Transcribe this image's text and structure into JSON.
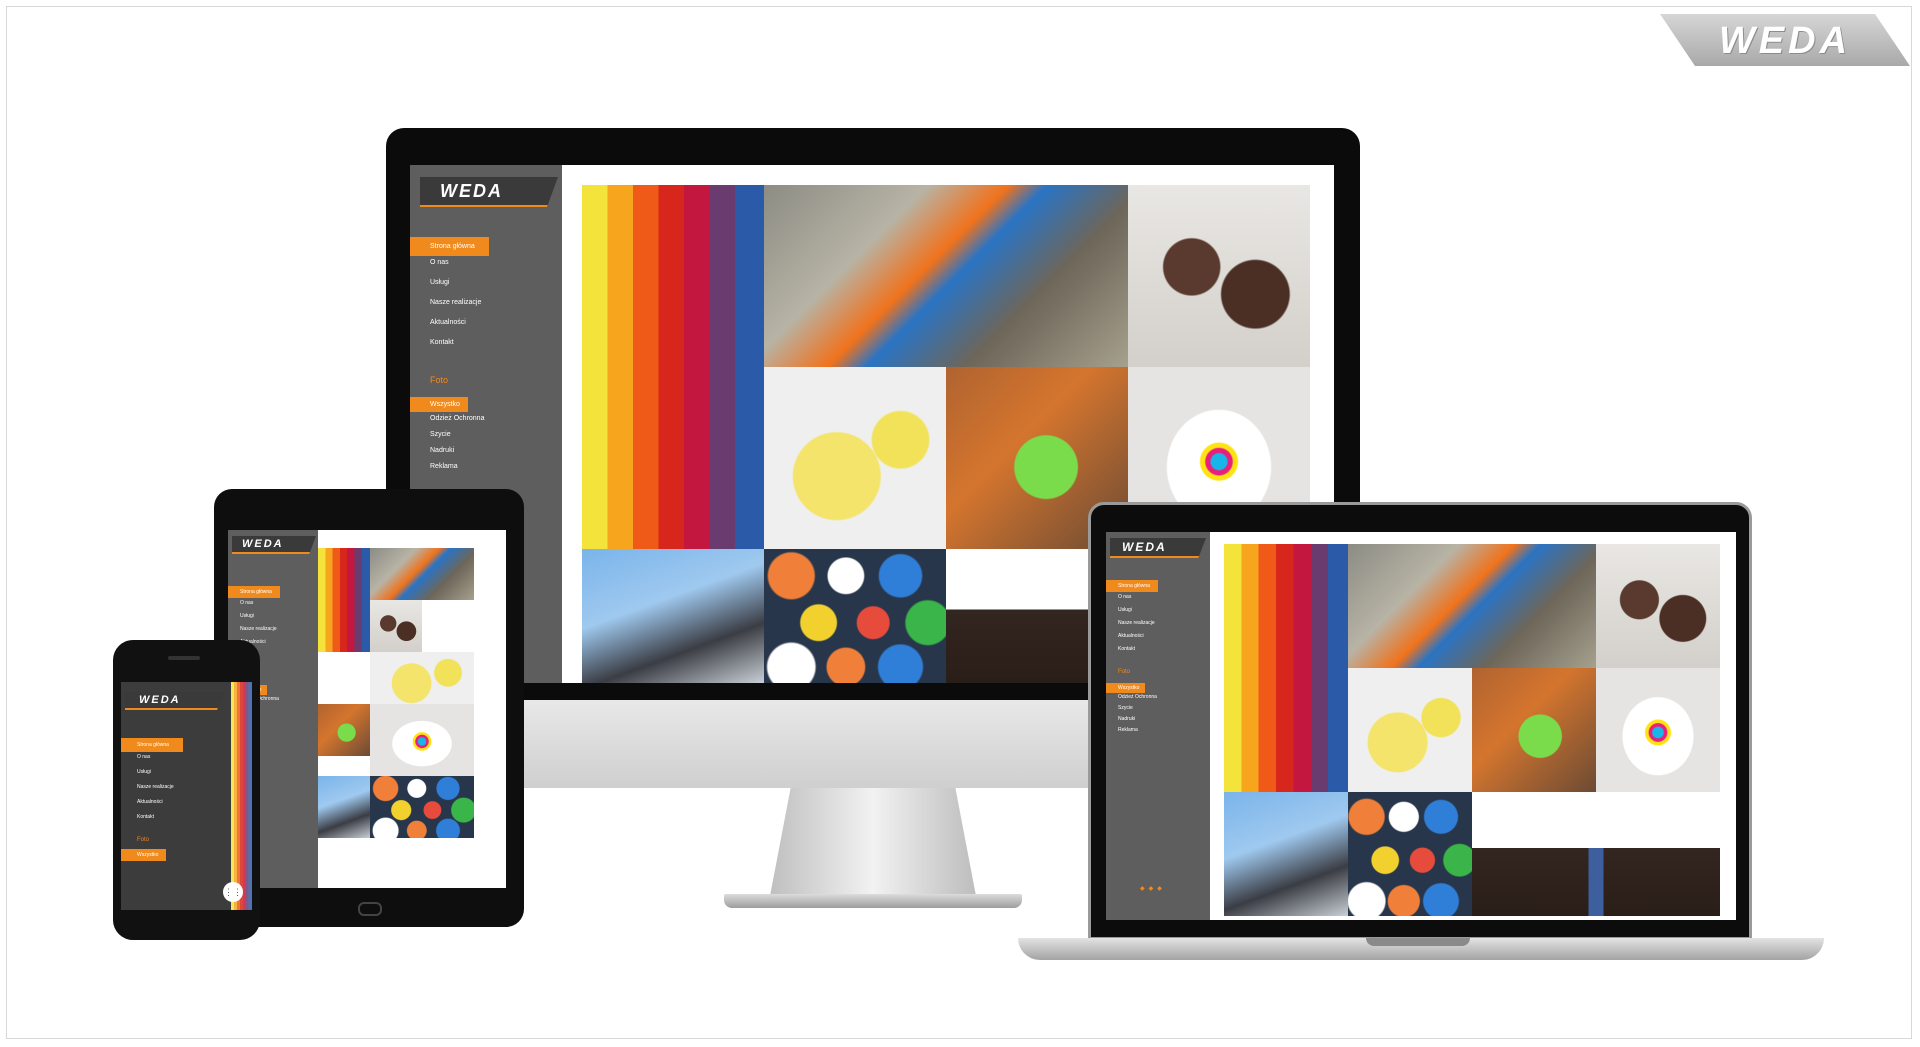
{
  "brand": {
    "name": "WEDA"
  },
  "site": {
    "logo": "WEDA",
    "menu": [
      "Strona główna",
      "O nas",
      "Usługi",
      "Nasze realizacje",
      "Aktualności",
      "Kontakt"
    ],
    "section": "Foto",
    "filters": [
      "Wszystko",
      "Odzież Ochronna",
      "Szycie",
      "Nadruki",
      "Reklama"
    ]
  },
  "gallery": {
    "tiles": [
      "thread-spools",
      "roofer-worker",
      "work-boots",
      "yellow-gloves",
      "green-glove-worker",
      "tshirt-cmyk",
      "rope-climbers",
      "hard-hats",
      "gift-box"
    ]
  },
  "colors": {
    "accent": "#f08a1c",
    "sidebar": "#5e5e5e",
    "logo_bar": "#3a3a3a"
  }
}
